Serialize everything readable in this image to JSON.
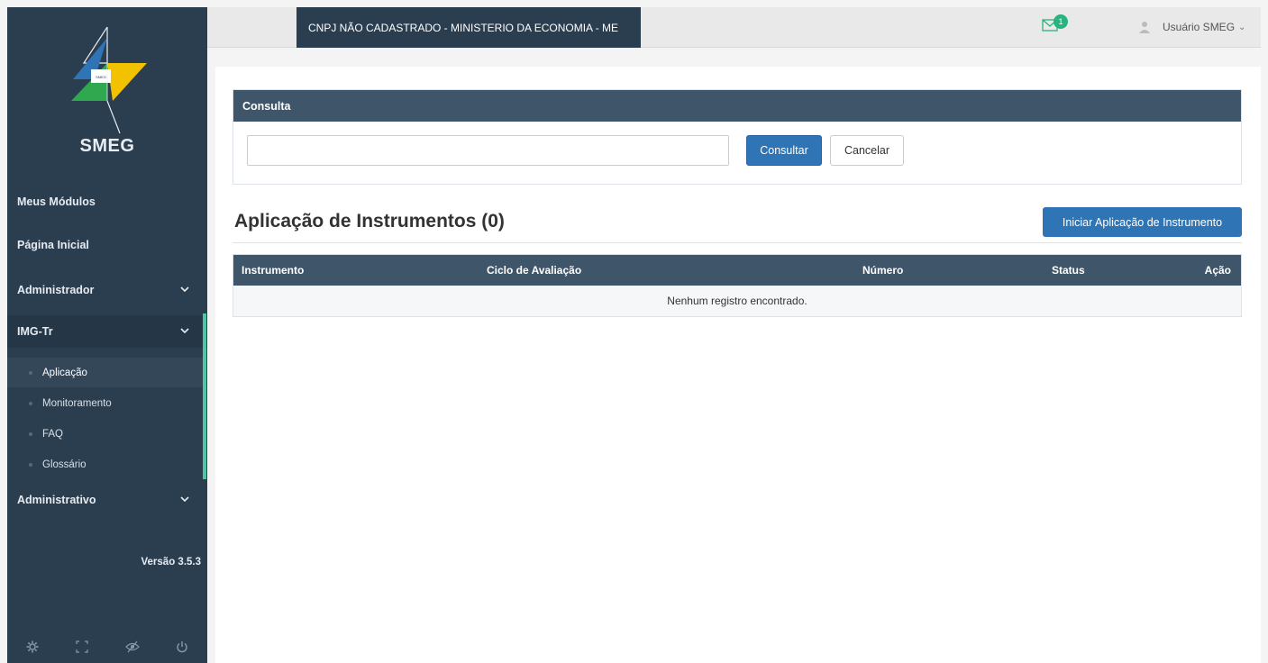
{
  "sidebar": {
    "logo_text": "SMEG",
    "logo_small_text": "SMEG",
    "items": [
      {
        "label": "Meus Módulos"
      },
      {
        "label": "Página Inicial"
      },
      {
        "label": "Administrador"
      },
      {
        "label": "IMG-Tr"
      },
      {
        "label": "Administrativo"
      }
    ],
    "sub_items": [
      {
        "label": "Aplicação"
      },
      {
        "label": "Monitoramento"
      },
      {
        "label": "FAQ"
      },
      {
        "label": "Glossário"
      }
    ],
    "version": "Versão 3.5.3",
    "footer_icons": [
      "gear-icon",
      "fullscreen-icon",
      "eye-off-icon",
      "power-icon"
    ]
  },
  "topbar": {
    "org": "CNPJ NÃO CADASTRADO - MINISTERIO DA ECONOMIA - ME",
    "notification_count": "1",
    "user_name": "Usuário SMEG",
    "user_caret": "⌄"
  },
  "consulta": {
    "title": "Consulta",
    "search_value": "",
    "search_placeholder": "",
    "submit_label": "Consultar",
    "cancel_label": "Cancelar"
  },
  "main": {
    "title": "Aplicação de Instrumentos (0)",
    "start_button": "Iniciar Aplicação de Instrumento",
    "table": {
      "columns": [
        "Instrumento",
        "Ciclo de Avaliação",
        "Número",
        "Status",
        "Ação"
      ],
      "empty_message": "Nenhum registro encontrado."
    }
  },
  "colors": {
    "sidebar_bg": "#2b3e50",
    "header_bg": "#3f5569",
    "primary": "#2f74b5",
    "accent_green": "#4cc7a4",
    "badge_green": "#29b37e"
  }
}
